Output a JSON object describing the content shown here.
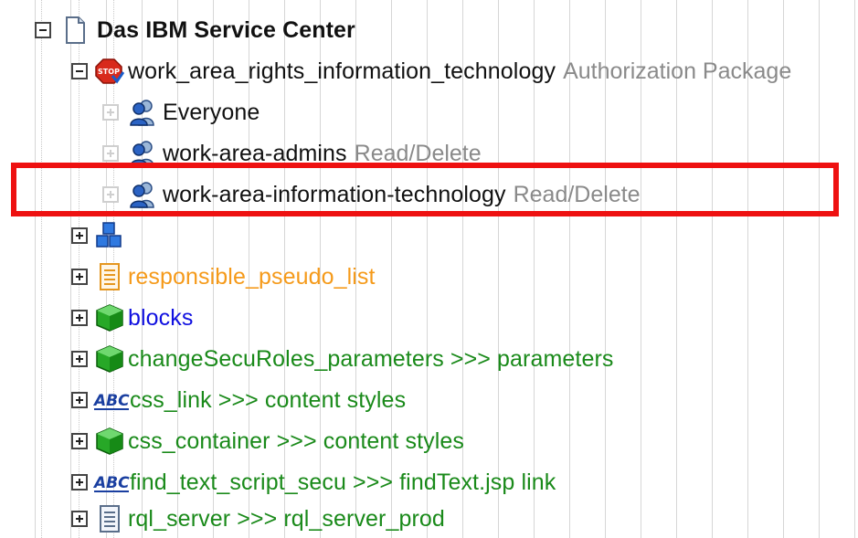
{
  "colors": {
    "black": "#111111",
    "orange": "#f59a1a",
    "blue": "#1010e0",
    "green": "#1a8a1a",
    "muted": "#8a8a8a",
    "highlight": "#ee1111"
  },
  "tree": {
    "root": {
      "label": "Das IBM Service Center",
      "icon": "document-icon"
    },
    "auth_package": {
      "label": "work_area_rights_information_technology",
      "suffix": "Authorization Package",
      "icon": "stop-sign-icon"
    },
    "groups": [
      {
        "label": "Everyone",
        "suffix": "",
        "icon": "user-group-icon"
      },
      {
        "label": "work-area-admins",
        "suffix": "Read/Delete",
        "icon": "user-group-icon"
      },
      {
        "label": "work-area-information-technology",
        "suffix": "Read/Delete",
        "icon": "user-group-icon"
      }
    ],
    "elements": [
      {
        "label": "",
        "icon": "cubes-icon"
      },
      {
        "label": "responsible_pseudo_list",
        "icon": "list-page-icon"
      },
      {
        "label": "blocks",
        "icon": "green-cube-icon"
      },
      {
        "label": "changeSecuRoles_parameters >>> parameters",
        "icon": "green-cube-icon"
      },
      {
        "label": "css_link >>> content styles",
        "icon": "abc-text-icon"
      },
      {
        "label": "css_container >>> content styles",
        "icon": "green-cube-icon"
      },
      {
        "label": "find_text_script_secu >>> findText.jsp link",
        "icon": "abc-text-icon"
      },
      {
        "label": "rql_server >>> rql_server_prod",
        "icon": "list-page-icon"
      }
    ]
  }
}
